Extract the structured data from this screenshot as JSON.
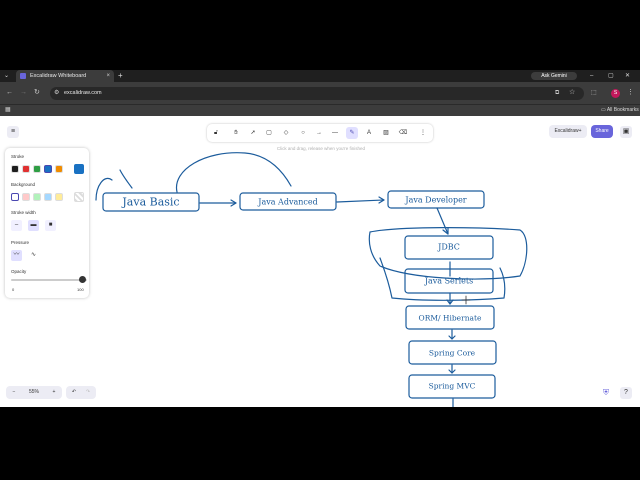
{
  "browser": {
    "tab_title": "Excalidraw Whiteboard",
    "url": "excalidraw.com",
    "gemini_label": "Ask Gemini",
    "avatar_letter": "S",
    "bookmarks_label": "All Bookmarks"
  },
  "app": {
    "hint": "Click and drag, release when you're finished",
    "library_button": "Excalidraw+",
    "share_button": "Share",
    "zoom_level": "55%",
    "accent_color": "#6965db"
  },
  "properties": {
    "stroke_label": "Stroke",
    "background_label": "Background",
    "stroke_width_label": "Stroke width",
    "pressure_label": "Pressure",
    "opacity_label": "Opacity",
    "opacity_min": "0",
    "opacity_max": "100",
    "stroke_colors": [
      "#1e1e1e",
      "#e03131",
      "#2f9e44",
      "#1971c2",
      "#f08c00"
    ],
    "selected_stroke": "#1971c2",
    "background_colors": [
      "#ffffff",
      "#ffc9c9",
      "#b2f2bb",
      "#a5d8ff",
      "#ffec99"
    ]
  },
  "diagram": {
    "stroke_color": "#1c5c9c",
    "nodes": [
      {
        "id": "java-basic",
        "label": "Java Basic"
      },
      {
        "id": "java-advanced",
        "label": "Java Advanced"
      },
      {
        "id": "java-developer",
        "label": "Java Developer"
      },
      {
        "id": "jdbc",
        "label": "JDBC"
      },
      {
        "id": "java-servlets",
        "label": "Java Serlets"
      },
      {
        "id": "orm-hibernate",
        "label": "ORM/ Hibernate"
      },
      {
        "id": "spring-core",
        "label": "Spring Core"
      },
      {
        "id": "spring-mvc",
        "label": "Spring MVC"
      }
    ]
  }
}
